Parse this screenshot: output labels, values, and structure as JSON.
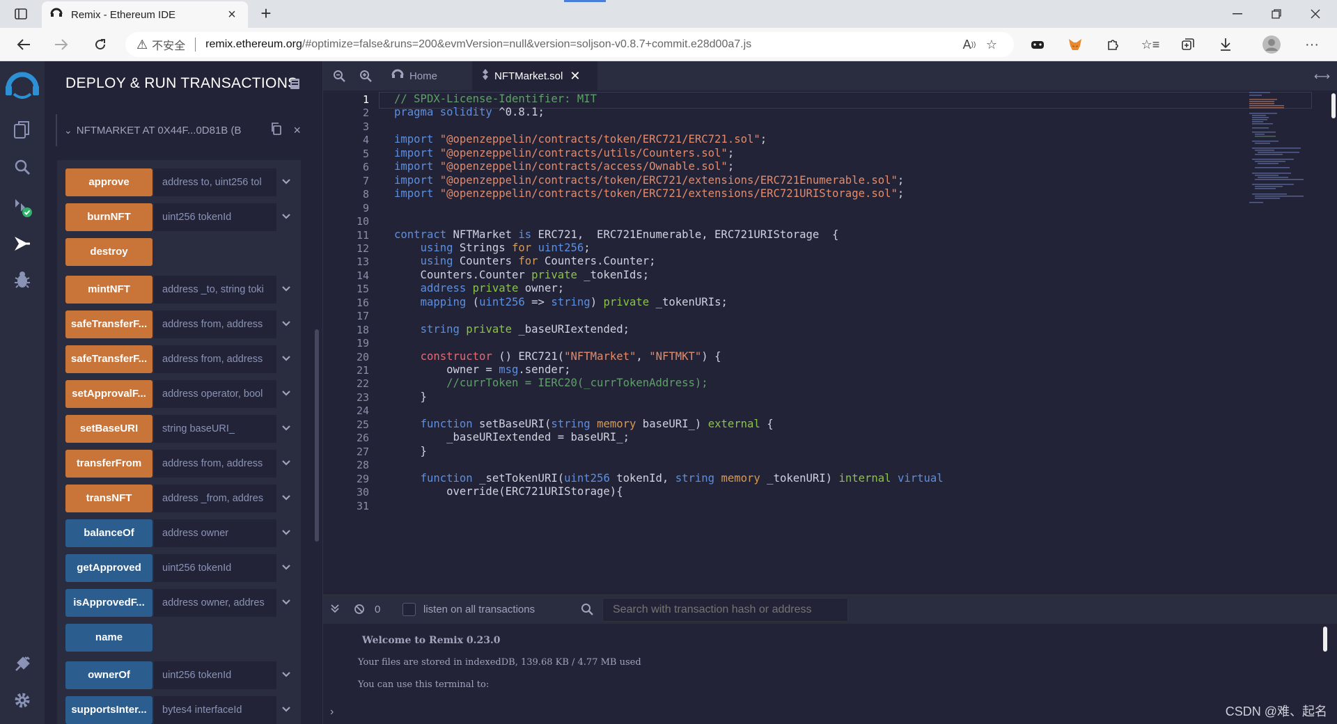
{
  "browser": {
    "tab_title": "Remix - Ethereum IDE",
    "security_label": "不安全",
    "url_domain": "remix.ethereum.org",
    "url_path": "/#optimize=false&runs=200&evmVersion=null&version=soljson-v0.8.7+commit.e28d00a7.js"
  },
  "sidepanel": {
    "title": "DEPLOY & RUN TRANSACTIONS",
    "instance_name": "NFTMARKET AT 0X44F...0D81B (B",
    "functions": [
      {
        "label": "approve",
        "placeholder": "address to, uint256 tol",
        "kind": "orange",
        "has_input": true
      },
      {
        "label": "burnNFT",
        "placeholder": "uint256 tokenId",
        "kind": "orange",
        "has_input": true
      },
      {
        "label": "destroy",
        "placeholder": "",
        "kind": "orange",
        "has_input": false
      },
      {
        "label": "mintNFT",
        "placeholder": "address _to, string toki",
        "kind": "orange",
        "has_input": true
      },
      {
        "label": "safeTransferF...",
        "placeholder": "address from, address",
        "kind": "orange",
        "has_input": true
      },
      {
        "label": "safeTransferF...",
        "placeholder": "address from, address",
        "kind": "orange",
        "has_input": true
      },
      {
        "label": "setApprovalF...",
        "placeholder": "address operator, bool",
        "kind": "orange",
        "has_input": true
      },
      {
        "label": "setBaseURI",
        "placeholder": "string baseURI_",
        "kind": "orange",
        "has_input": true
      },
      {
        "label": "transferFrom",
        "placeholder": "address from, address",
        "kind": "orange",
        "has_input": true
      },
      {
        "label": "transNFT",
        "placeholder": "address _from, addres",
        "kind": "orange",
        "has_input": true
      },
      {
        "label": "balanceOf",
        "placeholder": "address owner",
        "kind": "blue",
        "has_input": true
      },
      {
        "label": "getApproved",
        "placeholder": "uint256 tokenId",
        "kind": "blue",
        "has_input": true
      },
      {
        "label": "isApprovedF...",
        "placeholder": "address owner, addres",
        "kind": "blue",
        "has_input": true
      },
      {
        "label": "name",
        "placeholder": "",
        "kind": "blue",
        "has_input": false
      },
      {
        "label": "ownerOf",
        "placeholder": "uint256 tokenId",
        "kind": "blue",
        "has_input": true
      },
      {
        "label": "supportsInter...",
        "placeholder": "bytes4 interfaceId",
        "kind": "blue",
        "has_input": true
      }
    ]
  },
  "editor": {
    "tabs": [
      {
        "label": "Home"
      },
      {
        "label": "NFTMarket.sol"
      }
    ],
    "active_line": 1,
    "lines": [
      [
        [
          "c-com",
          "// SPDX-License-Identifier: MIT"
        ]
      ],
      [
        [
          "c-kw",
          "pragma solidity"
        ],
        [
          "",
          " ^0.8.1;"
        ]
      ],
      [],
      [
        [
          "c-kw",
          "import"
        ],
        [
          "",
          " "
        ],
        [
          "c-str",
          "\"@openzeppelin/contracts/token/ERC721/ERC721.sol\""
        ],
        [
          "",
          ";"
        ]
      ],
      [
        [
          "c-kw",
          "import"
        ],
        [
          "",
          " "
        ],
        [
          "c-str",
          "\"@openzeppelin/contracts/utils/Counters.sol\""
        ],
        [
          "",
          ";"
        ]
      ],
      [
        [
          "c-kw",
          "import"
        ],
        [
          "",
          " "
        ],
        [
          "c-str",
          "\"@openzeppelin/contracts/access/Ownable.sol\""
        ],
        [
          "",
          ";"
        ]
      ],
      [
        [
          "c-kw",
          "import"
        ],
        [
          "",
          " "
        ],
        [
          "c-str",
          "\"@openzeppelin/contracts/token/ERC721/extensions/ERC721Enumerable.sol\""
        ],
        [
          "",
          ";"
        ]
      ],
      [
        [
          "c-kw",
          "import"
        ],
        [
          "",
          " "
        ],
        [
          "c-str",
          "\"@openzeppelin/contracts/token/ERC721/extensions/ERC721URIStorage.sol\""
        ],
        [
          "",
          ";"
        ]
      ],
      [],
      [],
      [
        [
          "c-kw",
          "contract"
        ],
        [
          "",
          " NFTMarket "
        ],
        [
          "c-kw",
          "is"
        ],
        [
          "",
          " ERC721,  ERC721Enumerable, ERC721URIStorage  {"
        ]
      ],
      [
        [
          "",
          "    "
        ],
        [
          "c-kw",
          "using"
        ],
        [
          "",
          " Strings "
        ],
        [
          "c-mod",
          "for"
        ],
        [
          "",
          " "
        ],
        [
          "c-kw",
          "uint256"
        ],
        [
          "",
          ";"
        ]
      ],
      [
        [
          "",
          "    "
        ],
        [
          "c-kw",
          "using"
        ],
        [
          "",
          " Counters "
        ],
        [
          "c-mod",
          "for"
        ],
        [
          "",
          " Counters.Counter;"
        ]
      ],
      [
        [
          "",
          "    Counters.Counter "
        ],
        [
          "c-vis",
          "private"
        ],
        [
          "",
          " _tokenIds;"
        ]
      ],
      [
        [
          "",
          "    "
        ],
        [
          "c-kw",
          "address"
        ],
        [
          "",
          " "
        ],
        [
          "c-vis",
          "private"
        ],
        [
          "",
          " owner;"
        ]
      ],
      [
        [
          "",
          "    "
        ],
        [
          "c-kw",
          "mapping"
        ],
        [
          "",
          " ("
        ],
        [
          "c-kw",
          "uint256"
        ],
        [
          "",
          " => "
        ],
        [
          "c-kw",
          "string"
        ],
        [
          "",
          ") "
        ],
        [
          "c-vis",
          "private"
        ],
        [
          "",
          " _tokenURIs;"
        ]
      ],
      [],
      [
        [
          "",
          "    "
        ],
        [
          "c-kw",
          "string"
        ],
        [
          "",
          " "
        ],
        [
          "c-vis",
          "private"
        ],
        [
          "",
          " _baseURIextended;"
        ]
      ],
      [],
      [
        [
          "",
          "    "
        ],
        [
          "c-ctor",
          "constructor"
        ],
        [
          "",
          " () ERC721("
        ],
        [
          "c-str",
          "\"NFTMarket\""
        ],
        [
          "",
          ", "
        ],
        [
          "c-str",
          "\"NFTMKT\""
        ],
        [
          "",
          ") {"
        ]
      ],
      [
        [
          "",
          "        owner = "
        ],
        [
          "c-kw",
          "msg"
        ],
        [
          "",
          ".sender;"
        ]
      ],
      [
        [
          "",
          "        "
        ],
        [
          "c-com",
          "//currToken = IERC20(_currTokenAddress);"
        ]
      ],
      [
        [
          "",
          "    }"
        ]
      ],
      [],
      [
        [
          "",
          "    "
        ],
        [
          "c-kw",
          "function"
        ],
        [
          "",
          " setBaseURI("
        ],
        [
          "c-kw",
          "string"
        ],
        [
          "",
          " "
        ],
        [
          "c-mod",
          "memory"
        ],
        [
          "",
          " baseURI_) "
        ],
        [
          "c-vis",
          "external"
        ],
        [
          "",
          " {"
        ]
      ],
      [
        [
          "",
          "        _baseURIextended = baseURI_;"
        ]
      ],
      [
        [
          "",
          "    }"
        ]
      ],
      [],
      [
        [
          "",
          "    "
        ],
        [
          "c-kw",
          "function"
        ],
        [
          "",
          " _setTokenURI("
        ],
        [
          "c-kw",
          "uint256"
        ],
        [
          "",
          " tokenId, "
        ],
        [
          "c-kw",
          "string"
        ],
        [
          "",
          " "
        ],
        [
          "c-mod",
          "memory"
        ],
        [
          "",
          " _tokenURI) "
        ],
        [
          "c-vis",
          "internal"
        ],
        [
          "",
          " "
        ],
        [
          "c-kw",
          "virtual"
        ]
      ],
      [
        [
          "",
          "        override(ERC721URIStorage){"
        ]
      ]
    ]
  },
  "terminal": {
    "pending_count": "0",
    "listen_label": "listen on all transactions",
    "search_placeholder": "Search with transaction hash or address",
    "welcome": "Welcome to Remix 0.23.0",
    "storage_info": "Your files are stored in indexedDB, 139.68 KB / 4.77 MB used",
    "use_intro": "You can use this terminal to:",
    "watermark": "CSDN @难、起名"
  },
  "colors": {
    "orange_button": "#c97539",
    "blue_button": "#2b5d8f",
    "panel_bg": "#222336",
    "accent": "#2a2c3f"
  }
}
